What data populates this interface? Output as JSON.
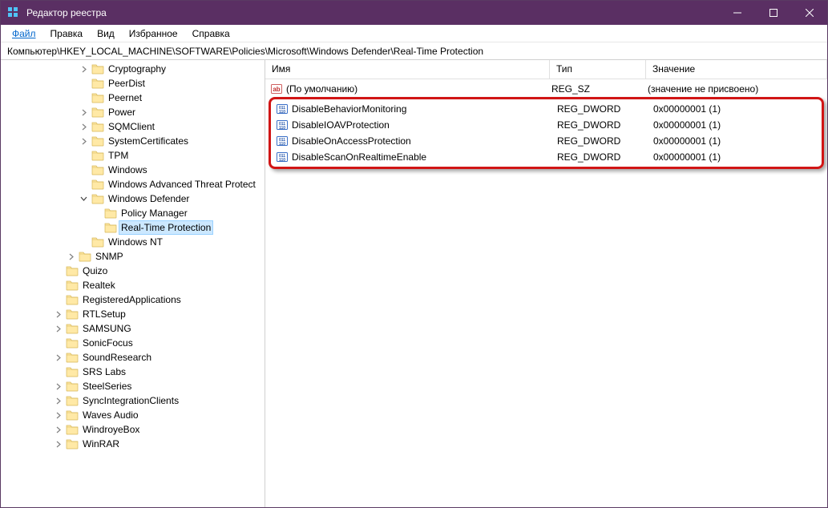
{
  "window": {
    "title": "Редактор реестра"
  },
  "menu": {
    "items": [
      "Файл",
      "Правка",
      "Вид",
      "Избранное",
      "Справка"
    ],
    "active_index": 0
  },
  "path": "Компьютер\\HKEY_LOCAL_MACHINE\\SOFTWARE\\Policies\\Microsoft\\Windows Defender\\Real-Time Protection",
  "tree": [
    {
      "indent": 6,
      "expander": "closed",
      "label": "Cryptography"
    },
    {
      "indent": 6,
      "expander": "none",
      "label": "PeerDist"
    },
    {
      "indent": 6,
      "expander": "none",
      "label": "Peernet"
    },
    {
      "indent": 6,
      "expander": "closed",
      "label": "Power"
    },
    {
      "indent": 6,
      "expander": "closed",
      "label": "SQMClient"
    },
    {
      "indent": 6,
      "expander": "closed",
      "label": "SystemCertificates"
    },
    {
      "indent": 6,
      "expander": "none",
      "label": "TPM"
    },
    {
      "indent": 6,
      "expander": "none",
      "label": "Windows"
    },
    {
      "indent": 6,
      "expander": "none",
      "label": "Windows Advanced Threat Protect"
    },
    {
      "indent": 6,
      "expander": "open",
      "label": "Windows Defender"
    },
    {
      "indent": 7,
      "expander": "none",
      "label": "Policy Manager"
    },
    {
      "indent": 7,
      "expander": "none",
      "label": "Real-Time Protection",
      "selected": true
    },
    {
      "indent": 6,
      "expander": "none",
      "label": "Windows NT"
    },
    {
      "indent": 5,
      "expander": "closed",
      "label": "SNMP"
    },
    {
      "indent": 4,
      "expander": "none",
      "label": "Quizo"
    },
    {
      "indent": 4,
      "expander": "none",
      "label": "Realtek"
    },
    {
      "indent": 4,
      "expander": "none",
      "label": "RegisteredApplications"
    },
    {
      "indent": 4,
      "expander": "closed",
      "label": "RTLSetup"
    },
    {
      "indent": 4,
      "expander": "closed",
      "label": "SAMSUNG"
    },
    {
      "indent": 4,
      "expander": "none",
      "label": "SonicFocus"
    },
    {
      "indent": 4,
      "expander": "closed",
      "label": "SoundResearch"
    },
    {
      "indent": 4,
      "expander": "none",
      "label": "SRS Labs"
    },
    {
      "indent": 4,
      "expander": "closed",
      "label": "SteelSeries"
    },
    {
      "indent": 4,
      "expander": "closed",
      "label": "SyncIntegrationClients"
    },
    {
      "indent": 4,
      "expander": "closed",
      "label": "Waves Audio"
    },
    {
      "indent": 4,
      "expander": "closed",
      "label": "WindroyeBox"
    },
    {
      "indent": 4,
      "expander": "closed",
      "label": "WinRAR"
    }
  ],
  "list": {
    "headers": {
      "name": "Имя",
      "type": "Тип",
      "value": "Значение"
    },
    "default_row": {
      "name": "(По умолчанию)",
      "type": "REG_SZ",
      "value": "(значение не присвоено)",
      "icon": "string"
    },
    "rows": [
      {
        "name": "DisableBehaviorMonitoring",
        "type": "REG_DWORD",
        "value": "0x00000001 (1)",
        "icon": "dword"
      },
      {
        "name": "DisableIOAVProtection",
        "type": "REG_DWORD",
        "value": "0x00000001 (1)",
        "icon": "dword"
      },
      {
        "name": "DisableOnAccessProtection",
        "type": "REG_DWORD",
        "value": "0x00000001 (1)",
        "icon": "dword"
      },
      {
        "name": "DisableScanOnRealtimeEnable",
        "type": "REG_DWORD",
        "value": "0x00000001 (1)",
        "icon": "dword"
      }
    ]
  }
}
